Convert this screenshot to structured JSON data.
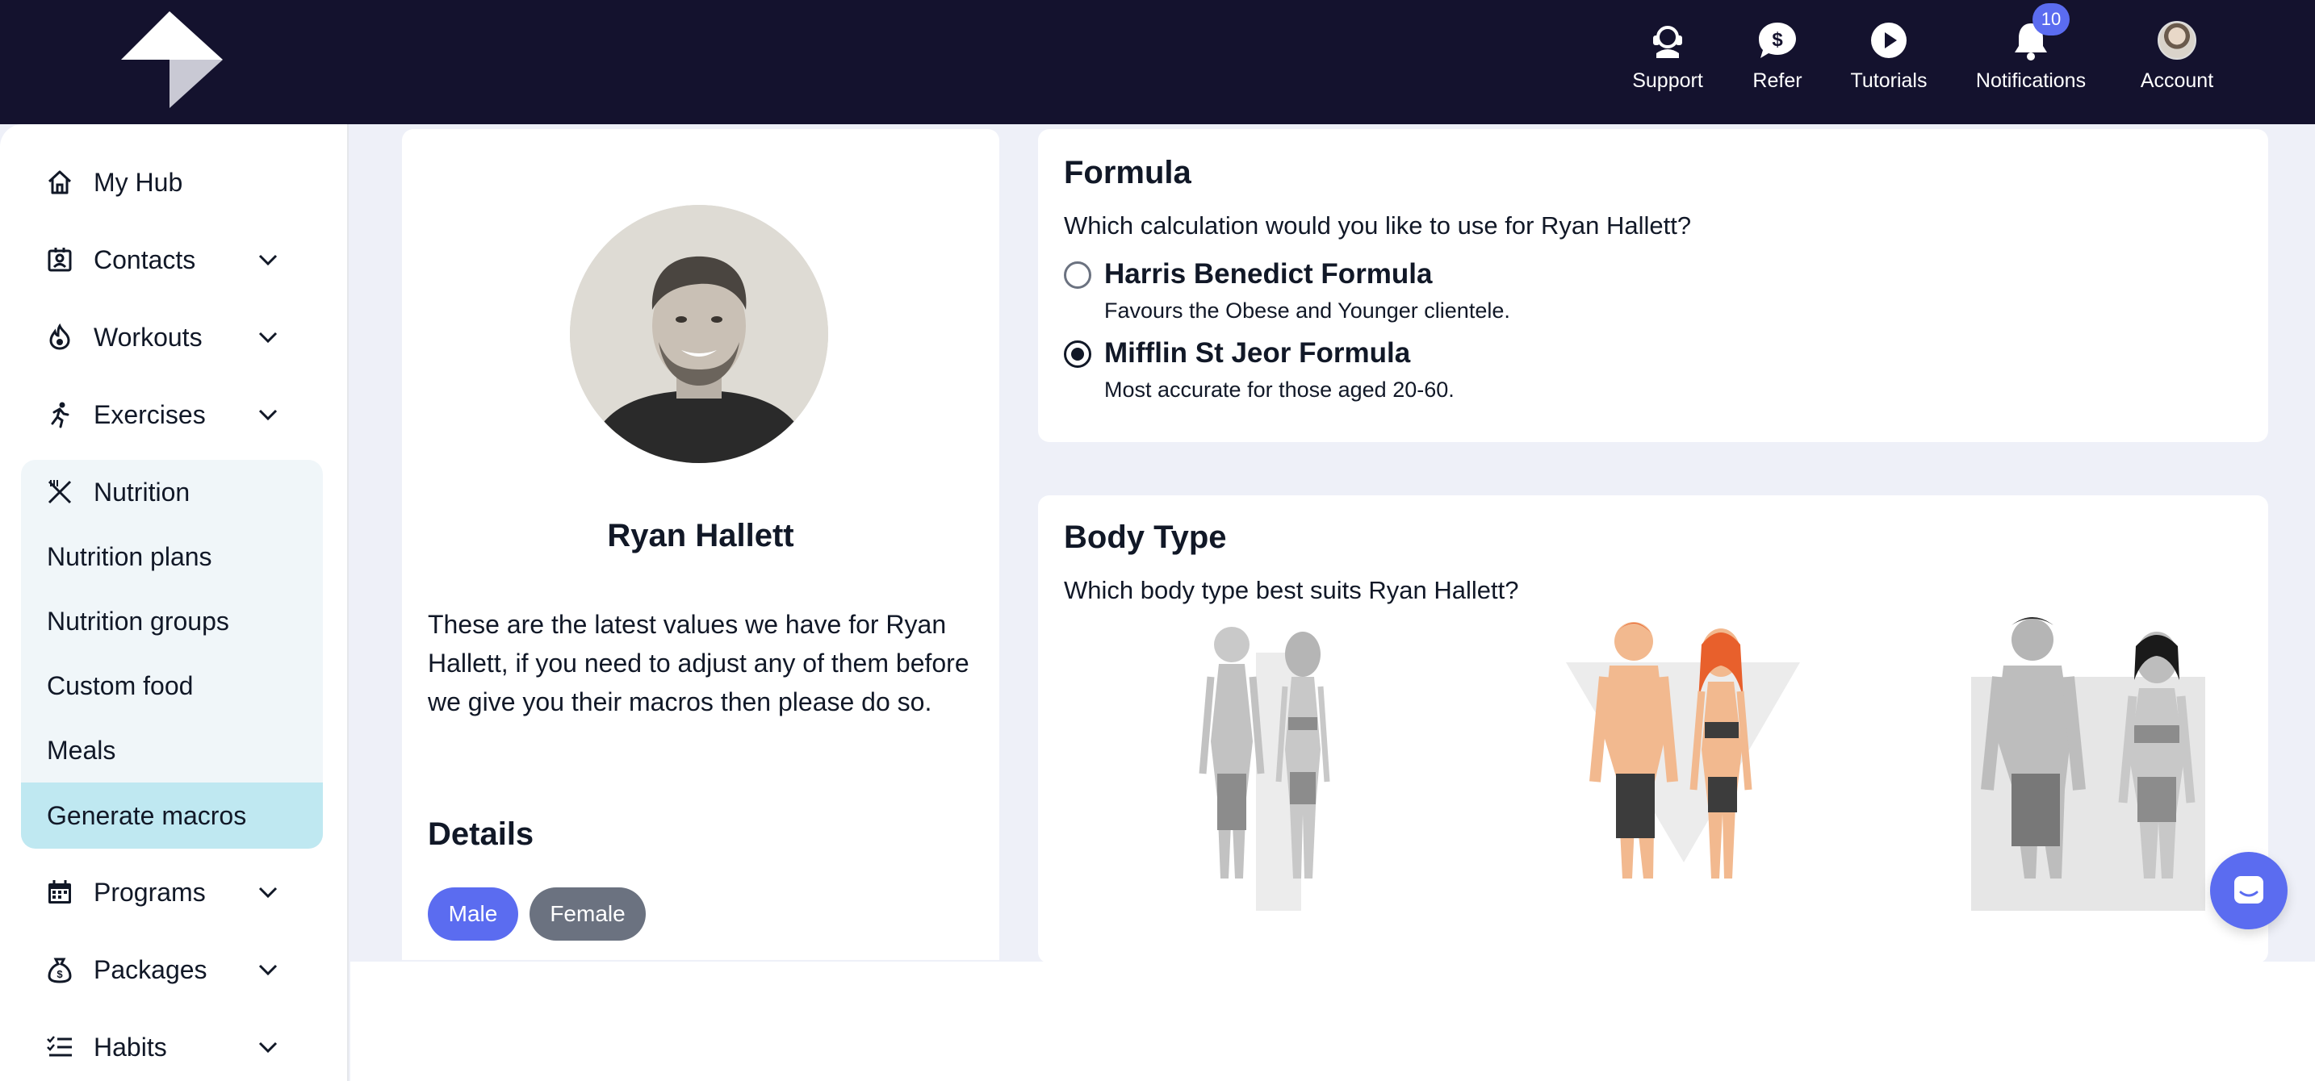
{
  "topnav": {
    "items": [
      {
        "label": "Support",
        "icon": "support-icon"
      },
      {
        "label": "Refer",
        "icon": "dollar-chat-icon"
      },
      {
        "label": "Tutorials",
        "icon": "play-icon"
      },
      {
        "label": "Notifications",
        "icon": "bell-icon",
        "badge": "10"
      },
      {
        "label": "Account",
        "icon": "avatar"
      }
    ]
  },
  "sidebar": {
    "my_hub": "My Hub",
    "contacts": "Contacts",
    "workouts": "Workouts",
    "exercises": "Exercises",
    "nutrition": "Nutrition",
    "nutrition_sub": [
      "Nutrition plans",
      "Nutrition groups",
      "Custom food",
      "Meals",
      "Generate macros"
    ],
    "programs": "Programs",
    "packages": "Packages",
    "habits": "Habits"
  },
  "profile": {
    "name": "Ryan Hallett",
    "description": "These are the latest values we have for Ryan Hallett, if you need to adjust any of them before we give you their macros then please do so.",
    "details_title": "Details",
    "gender_options": [
      "Male",
      "Female"
    ],
    "selected_gender": "Male"
  },
  "formula": {
    "title": "Formula",
    "question": "Which calculation would you like to use for Ryan Hallett?",
    "options": [
      {
        "label": "Harris Benedict Formula",
        "desc": "Favours the Obese and Younger clientele.",
        "selected": false
      },
      {
        "label": "Mifflin St Jeor Formula",
        "desc": "Most accurate for those aged 20-60.",
        "selected": true
      }
    ]
  },
  "body_type": {
    "title": "Body Type",
    "question": "Which body type best suits Ryan Hallett?"
  },
  "colors": {
    "topbar": "#14122e",
    "accent": "#5b6cf0",
    "active_sub": "#bfe8f1"
  }
}
